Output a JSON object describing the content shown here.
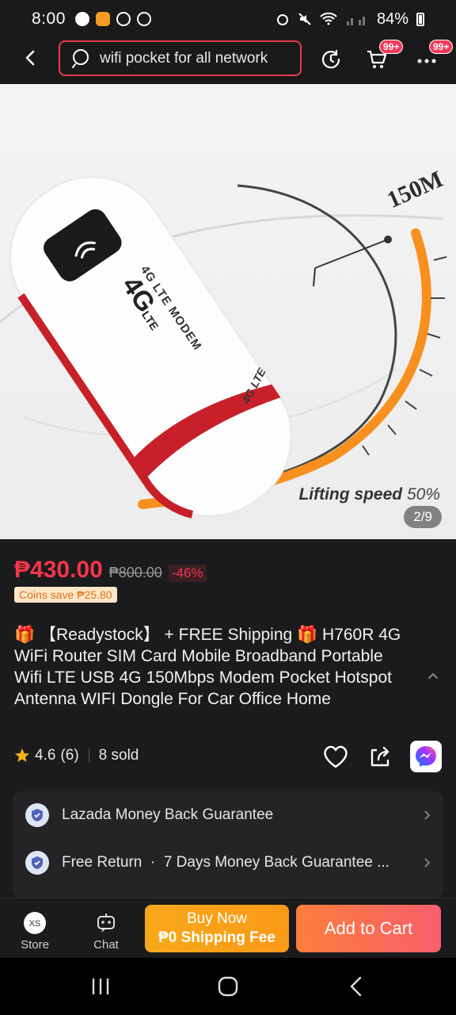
{
  "status_bar": {
    "time": "8:00",
    "battery": "84%"
  },
  "app_bar": {
    "search_value": "wifi pocket for all network",
    "cart_badge": "99+",
    "more_badge": "99+"
  },
  "gallery": {
    "counter": "2/9",
    "speed_text": "Lifting speed",
    "speed_percent": "50%",
    "speed_value": "150M",
    "device_brand": "4G",
    "device_brand_suffix": "LTE",
    "device_label": "4G LTE MODEM",
    "device_logo_small": "4G LTE"
  },
  "product": {
    "price": "₱430.00",
    "original_price": "₱800.00",
    "discount": "-46%",
    "coins_save": "Coins save ₱25.80",
    "title": "🎁 【Readystock】 + FREE Shipping 🎁 H760R 4G WiFi Router SIM Card Mobile Broadband Portable Wifi LTE USB 4G 150Mbps Modem Pocket Hotspot Antenna WIFI Dongle For Car Office Home",
    "rating": "4.6",
    "reviews": "(6)",
    "sold": "8 sold"
  },
  "guarantees": [
    {
      "label": "Lazada Money Back Guarantee"
    },
    {
      "label": "Free Return  ·  7 Days Money Back Guarantee ..."
    }
  ],
  "bottom_bar": {
    "store_label": "Store",
    "chat_label": "Chat",
    "buy_now_line1": "Buy Now",
    "buy_now_line2": "₱0 Shipping Fee",
    "add_to_cart": "Add to Cart"
  },
  "colors": {
    "accent_red": "#f5354b",
    "buy_now": "#f8a81b",
    "add_to_cart": "#f85f6c"
  }
}
